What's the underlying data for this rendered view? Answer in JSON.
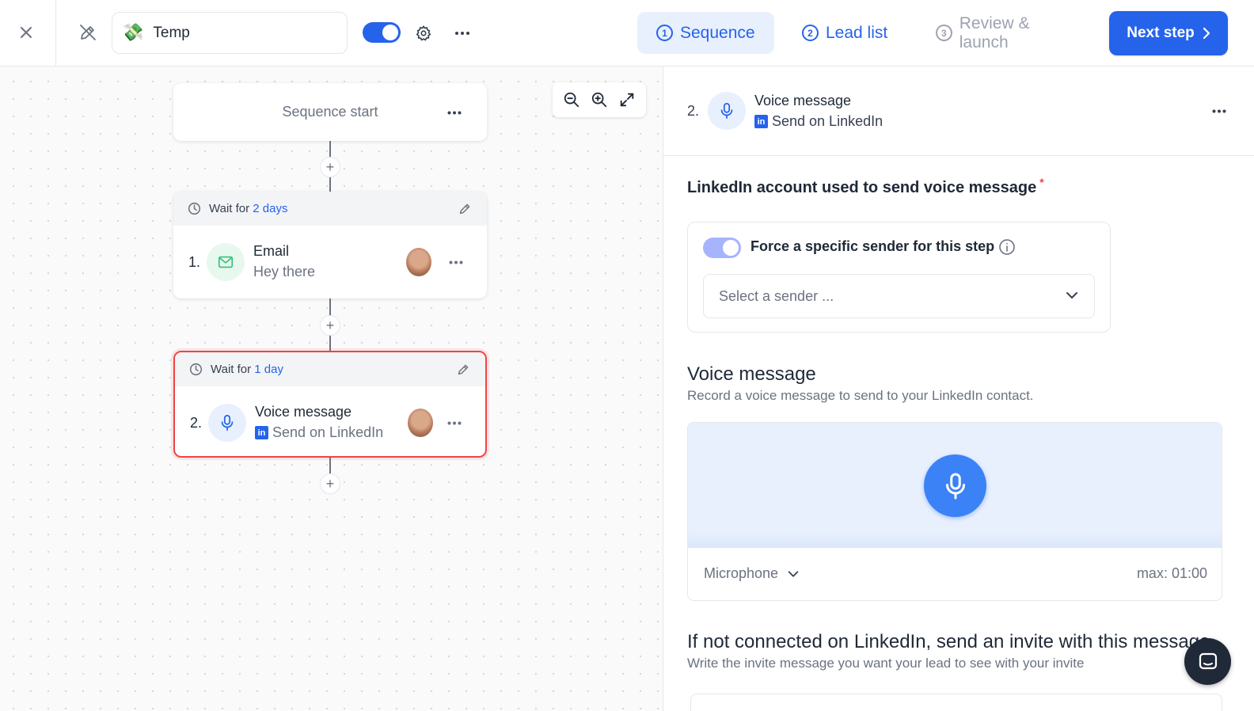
{
  "header": {
    "campaign_name": "Temp",
    "campaign_emoji": "💸",
    "active": true,
    "tabs": [
      {
        "num": "1",
        "label": "Sequence",
        "state": "active"
      },
      {
        "num": "2",
        "label": "Lead list",
        "state": "enabled"
      },
      {
        "num": "3",
        "label": "Review & launch",
        "state": "disabled"
      }
    ],
    "next_label": "Next step"
  },
  "canvas": {
    "start_label": "Sequence start",
    "steps": [
      {
        "wait_prefix": "Wait for",
        "wait_value": "2 days",
        "index": "1.",
        "title": "Email",
        "subtitle": "Hey there",
        "icon": "mail-icon"
      },
      {
        "wait_prefix": "Wait for",
        "wait_value": "1 day",
        "index": "2.",
        "title": "Voice message",
        "subtitle": "Send on LinkedIn",
        "icon": "microphone-icon",
        "selected": true
      }
    ]
  },
  "panel": {
    "index": "2.",
    "title": "Voice message",
    "subtitle": "Send on LinkedIn",
    "linkedin_badge": "in",
    "account_label": "LinkedIn account used to send voice message",
    "required_mark": "*",
    "force_label": "Force a specific sender for this step",
    "force_enabled": true,
    "sender_placeholder": "Select a sender ...",
    "voice_title": "Voice message",
    "voice_desc": "Record a voice message to send to your LinkedIn contact.",
    "microphone_label": "Microphone",
    "max_label": "max: 01:00",
    "invite_title": "If not connected on LinkedIn, send an invite with this message",
    "invite_desc": "Write the invite message you want your lead to see with your invite"
  },
  "colors": {
    "accent": "#2563eb",
    "selected_border": "#ef4444",
    "email_icon_bg": "#e7f8ef"
  }
}
